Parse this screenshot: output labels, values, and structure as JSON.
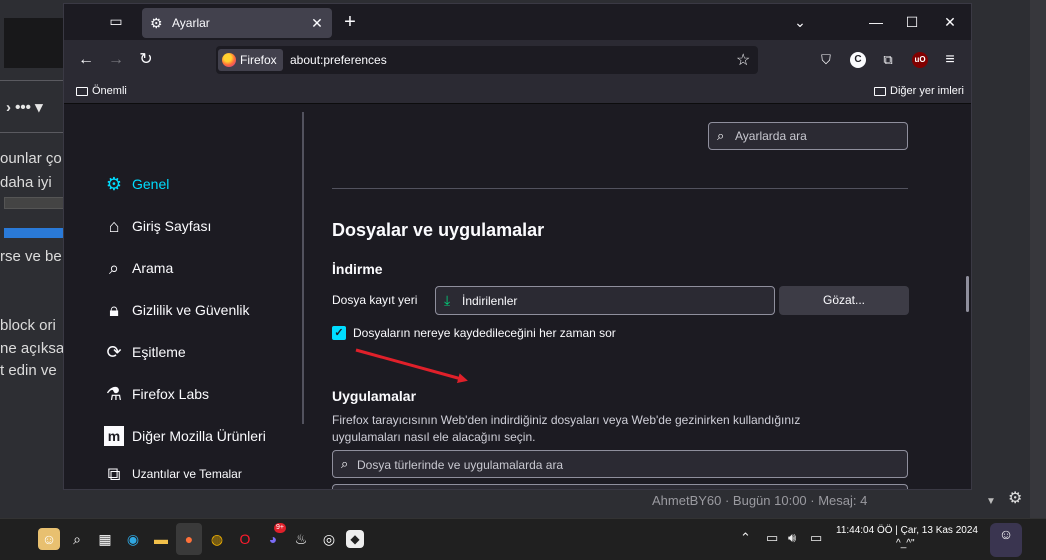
{
  "background": {
    "nav_symbols": "›  •••  ▾",
    "snippets": [
      "ounlar ço",
      " daha iyi",
      "rse ve be",
      "block ori",
      "ne açıksa",
      "t edin ve"
    ],
    "status_line": "AhmetBY60 · Bugün 10:00 · Mesaj: 4"
  },
  "tabbar": {
    "tab_title": "Ayarlar",
    "new_tab": "+",
    "minimize": "—",
    "maximize": "☐",
    "close": "✕"
  },
  "navbar": {
    "identity_label": "Firefox",
    "url": "about:preferences",
    "account_initial": "C",
    "ublock_label": "uO"
  },
  "bookmarks": {
    "left": "Önemli",
    "right": "Diğer yer imleri"
  },
  "sidebar": {
    "items": [
      {
        "label": "Genel",
        "icon": "gear-icon"
      },
      {
        "label": "Giriş Sayfası",
        "icon": "home-icon"
      },
      {
        "label": "Arama",
        "icon": "search-icon"
      },
      {
        "label": "Gizlilik ve Güvenlik",
        "icon": "lock-icon"
      },
      {
        "label": "Eşitleme",
        "icon": "sync-icon"
      },
      {
        "label": "Firefox Labs",
        "icon": "labs-icon"
      },
      {
        "label": "Diğer Mozilla Ürünleri",
        "icon": "mozilla-icon"
      },
      {
        "label": "Uzantılar ve Temalar",
        "icon": "puzzle-icon"
      }
    ]
  },
  "main": {
    "search_placeholder": "Ayarlarda ara",
    "section_title": "Dosyalar ve uygulamalar",
    "downloads_heading": "İndirme",
    "save_label": "Dosya kayıt yeri",
    "save_folder": "İndirilenler",
    "browse_button": "Gözat...",
    "always_ask_label": "Dosyaların nereye kaydedileceğini her zaman sor",
    "always_ask_checked": true,
    "apps_heading": "Uygulamalar",
    "apps_description": "Firefox tarayıcısının Web'den indirdiğiniz dosyaları veya Web'de gezinirken kullandığınız uygulamaları nasıl ele alacağını seçin.",
    "apps_search_placeholder": "Dosya türlerinde ve uygulamalarda ara"
  },
  "annotation": {
    "color": "#e0202a"
  },
  "taskbar": {
    "time": "11:44:04 ÖÖ | Çar, 13 Kas 2024",
    "sub": "^_^\"",
    "chrome_badge": "9+"
  },
  "colors": {
    "accent": "#00ddff",
    "window_bg": "#1c1b22"
  }
}
